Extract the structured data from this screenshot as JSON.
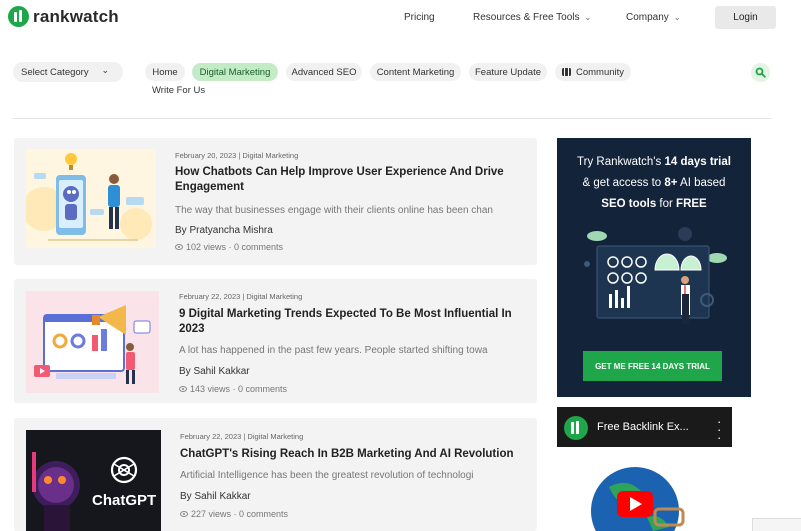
{
  "brand": {
    "name": "rankwatch",
    "color": "#1fa64a"
  },
  "nav": {
    "pricing": "Pricing",
    "resources": "Resources & Free Tools",
    "company": "Company",
    "login": "Login"
  },
  "filters": {
    "select_category": "Select Category",
    "chips": [
      "Home",
      "Digital Marketing",
      "Advanced SEO",
      "Content Marketing",
      "Feature Update",
      "Community",
      "Write For Us"
    ],
    "active_chip": "Digital Marketing"
  },
  "articles": [
    {
      "date": "February 20, 2023 | Digital Marketing",
      "title_line1": "How Chatbots Can Help Improve User Experience And Drive",
      "title_line2": "Engagement",
      "excerpt": "The way that businesses engage with their clients online has been chan",
      "author": "By Pratyancha Mishra",
      "stats": "102 views  ·  0 comments"
    },
    {
      "date": "February 22, 2023 | Digital Marketing",
      "title_line1": "9 Digital Marketing Trends Expected To Be Most Influential In",
      "title_line2": "2023",
      "excerpt": "A lot has happened in the past few years. People started shifting towa",
      "author": "By Sahil Kakkar",
      "stats": "143 views  ·  0 comments"
    },
    {
      "date": "February 22, 2023 | Digital Marketing",
      "title_line1": "ChatGPT's Rising Reach In B2B Marketing And AI Revolution",
      "title_line2": "",
      "excerpt": "Artificial Intelligence has been the greatest revolution of technologi",
      "author": "By Sahil Kakkar",
      "stats": "227 views  ·  0 comments",
      "thumb_text": "ChatGPT"
    }
  ],
  "promo": {
    "line1_pre": "Try Rankwatch's ",
    "line1_bold": "14 days trial",
    "line2_pre": "& get access to ",
    "line2_bold": "8+",
    "line2_post": " AI based",
    "line3_bold": "SEO tools",
    "line3_post": " for ",
    "line3_bold2": "FREE",
    "cta": "GET ME FREE 14 DAYS TRIAL",
    "bg": "#13233a"
  },
  "video": {
    "title": "Free Backlink Ex..."
  }
}
